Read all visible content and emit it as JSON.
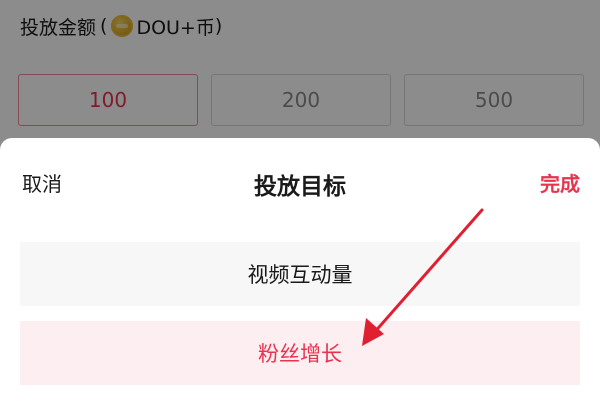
{
  "amount": {
    "label": "投放金额",
    "paren_open": "(",
    "currency": "DOU+币",
    "paren_close": ")",
    "options": [
      "100",
      "200",
      "500"
    ],
    "selected": "100"
  },
  "sheet": {
    "cancel_label": "取消",
    "title": "投放目标",
    "done_label": "完成",
    "options": [
      "视频互动量",
      "粉丝增长"
    ],
    "selected": "粉丝增长"
  },
  "colors": {
    "accent": "#e8334f",
    "selected_bg": "#fdeef1",
    "option_bg": "#f7f7f7",
    "arrow": "#e02030"
  },
  "icons": {
    "coin": "dou-coin-icon"
  }
}
